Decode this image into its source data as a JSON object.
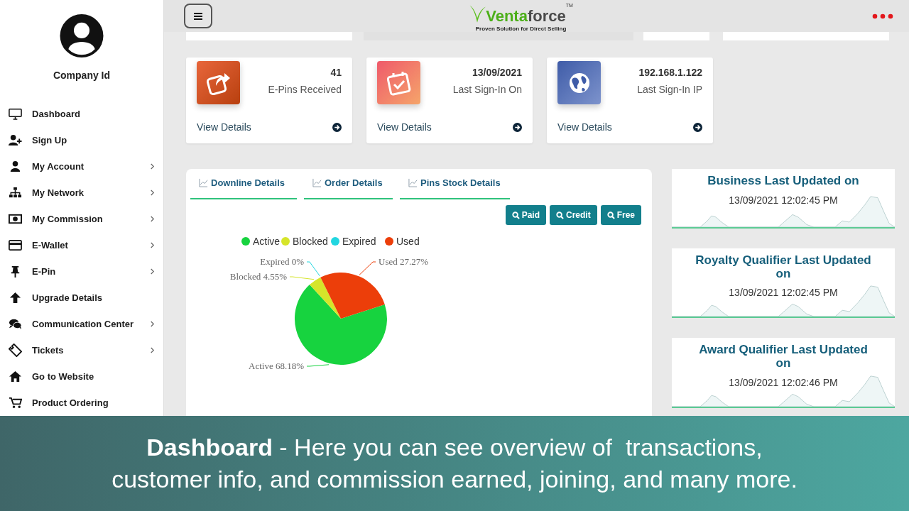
{
  "sidebar": {
    "profile_label": "Company Id",
    "items": [
      {
        "label": "Dashboard",
        "has_submenu": false
      },
      {
        "label": "Sign Up",
        "has_submenu": false
      },
      {
        "label": "My Account",
        "has_submenu": true
      },
      {
        "label": "My Network",
        "has_submenu": true
      },
      {
        "label": "My Commission",
        "has_submenu": true
      },
      {
        "label": "E-Wallet",
        "has_submenu": true
      },
      {
        "label": "E-Pin",
        "has_submenu": true
      },
      {
        "label": "Upgrade Details",
        "has_submenu": false
      },
      {
        "label": "Communication Center",
        "has_submenu": true
      },
      {
        "label": "Tickets",
        "has_submenu": true
      },
      {
        "label": "Go to Website",
        "has_submenu": false
      },
      {
        "label": "Product Ordering",
        "has_submenu": false
      }
    ]
  },
  "header": {
    "logo": {
      "accent": "Venta",
      "rest": "force",
      "tm": "TM",
      "tagline": "Proven Solution for Direct Selling"
    }
  },
  "stat_cards": [
    {
      "value": "41",
      "label": "E-Pins Received",
      "link": "View Details"
    },
    {
      "value": "13/09/2021",
      "label": "Last Sign-In On",
      "link": "View Details"
    },
    {
      "value": "192.168.1.122",
      "label": "Last Sign-In IP",
      "link": "View Details"
    }
  ],
  "details_panel": {
    "tabs": [
      {
        "label": "Downline Details"
      },
      {
        "label": "Order Details"
      },
      {
        "label": "Pins Stock Details"
      }
    ],
    "filter_buttons": [
      "Paid",
      "Credit",
      "Free"
    ],
    "chart_data": {
      "type": "pie",
      "legend": "top",
      "categories": [
        "Active",
        "Blocked",
        "Expired",
        "Used"
      ],
      "values": [
        68.18,
        4.55,
        0,
        27.27
      ],
      "value_labels": [
        "Active 68.18%",
        "Blocked 4.55%",
        "Expired 0%",
        "Used 27.27%"
      ]
    }
  },
  "update_cards": [
    {
      "title": "Business Last Updated on",
      "timestamp": "13/09/2021 12:02:45 PM"
    },
    {
      "title": "Royalty Qualifier Last Updated on",
      "timestamp": "13/09/2021 12:02:45 PM"
    },
    {
      "title": "Award Qualifier Last Updated on",
      "timestamp": "13/09/2021 12:02:46 PM"
    }
  ],
  "caption": {
    "lines": [
      "**Dashboard** - Here you can see overview of  transactions,",
      "customer info, and commission earned, joining, and many more."
    ]
  }
}
